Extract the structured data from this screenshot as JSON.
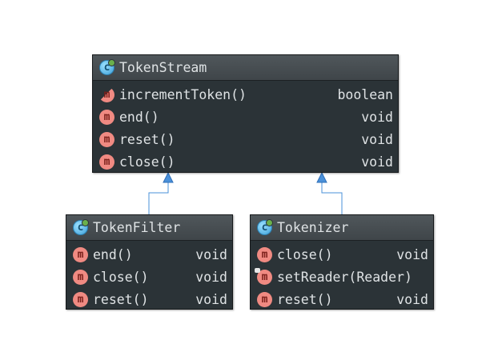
{
  "classes": {
    "token_stream": {
      "icon": "class-icon",
      "title": "TokenStream",
      "members": [
        {
          "name": "incrementToken()",
          "type": "boolean",
          "icon": "method-icon",
          "modifier": "abstract"
        },
        {
          "name": "end()",
          "type": "void",
          "icon": "method-icon"
        },
        {
          "name": "reset()",
          "type": "void",
          "icon": "method-icon"
        },
        {
          "name": "close()",
          "type": "void",
          "icon": "method-icon"
        }
      ]
    },
    "token_filter": {
      "icon": "class-icon",
      "title": "TokenFilter",
      "members": [
        {
          "name": "end()",
          "type": "void",
          "icon": "method-icon"
        },
        {
          "name": "close()",
          "type": "void",
          "icon": "method-icon"
        },
        {
          "name": "reset()",
          "type": "void",
          "icon": "method-icon"
        }
      ]
    },
    "tokenizer": {
      "icon": "class-icon",
      "title": "Tokenizer",
      "members": [
        {
          "name": "close()",
          "type": "void",
          "icon": "method-icon"
        },
        {
          "name": "setReader(Reader)",
          "type": "",
          "icon": "method-icon",
          "modifier": "locked"
        },
        {
          "name": "reset()",
          "type": "void",
          "icon": "method-icon"
        }
      ]
    }
  },
  "relations": [
    {
      "from": "token_filter",
      "to": "token_stream",
      "kind": "extends"
    },
    {
      "from": "tokenizer",
      "to": "token_stream",
      "kind": "extends"
    }
  ],
  "icon_letters": {
    "class": "c",
    "method": "m"
  },
  "colors": {
    "box_bg": "#2b3337",
    "header_bg": "#474e52",
    "text": "#dfe3e5",
    "method_badge": "#f08a82",
    "class_badge": "#5ab4e6",
    "edge": "#4a90d9"
  }
}
